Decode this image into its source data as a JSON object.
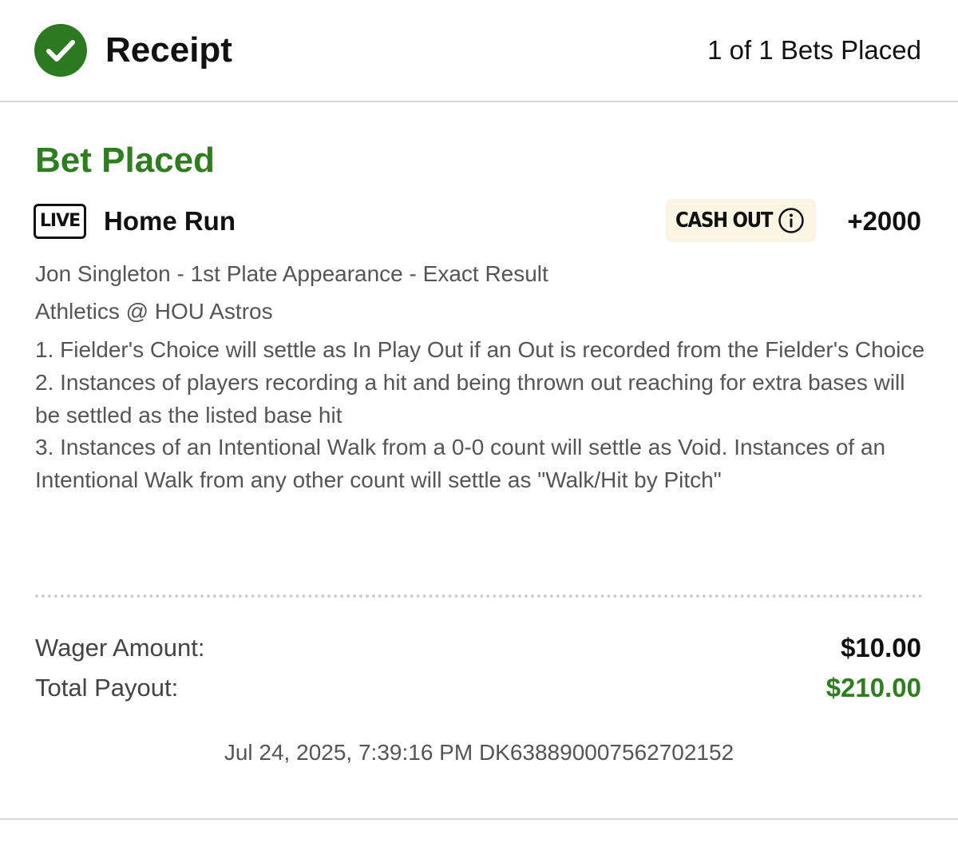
{
  "header": {
    "title": "Receipt",
    "bets_placed": "1 of 1 Bets Placed",
    "icon": "check-circle-icon"
  },
  "bet": {
    "status": "Bet Placed",
    "live_badge": "LIVE",
    "type": "Home Run",
    "cash_out_label": "CASH OUT",
    "odds": "+2000",
    "selection": "Jon Singleton - 1st Plate Appearance - Exact Result",
    "event": "Athletics @ HOU Astros",
    "rules": [
      "1. Fielder's Choice will settle as In Play Out if an Out is recorded from the Fielder's Choice",
      "2. Instances of players recording a hit and being thrown out reaching for extra bases will be settled as the listed base hit",
      "3. Instances of an Intentional Walk from a 0-0 count will settle as Void. Instances of an Intentional Walk from any other count will settle as \"Walk/Hit by Pitch\""
    ]
  },
  "summary": {
    "wager_label": "Wager Amount:",
    "wager_value": "$10.00",
    "payout_label": "Total Payout:",
    "payout_value": "$210.00"
  },
  "footer": {
    "meta": "Jul 24, 2025, 7:39:16 PM DK638890007562702152"
  },
  "colors": {
    "brand_green": "#2e7d1e",
    "check_green": "#2b7a1f",
    "cashout_bg": "#fbf6e3"
  }
}
